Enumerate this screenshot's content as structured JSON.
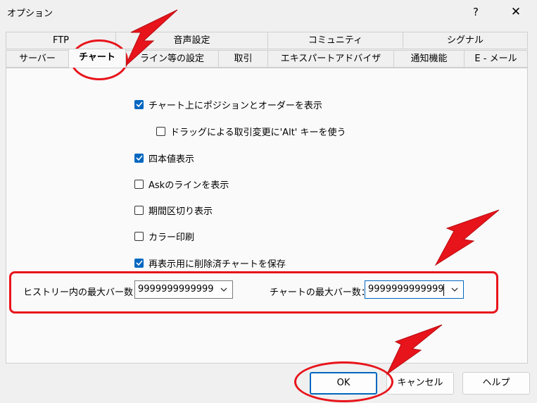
{
  "window": {
    "title": "オプション",
    "help_glyph": "?",
    "close_glyph": "✕"
  },
  "tabs_row1": [
    "FTP",
    "音声設定",
    "コミュニティ",
    "シグナル"
  ],
  "tabs_row2": [
    "サーバー",
    "チャート",
    "ライン等の設定",
    "取引",
    "エキスパートアドバイザ",
    "通知機能",
    "E - メール"
  ],
  "active_tab": "チャート",
  "options": [
    {
      "label": "チャート上にポジションとオーダーを表示",
      "checked": true
    },
    {
      "label": "ドラッグによる取引変更に'Alt' キーを使う",
      "checked": false
    },
    {
      "label": "四本値表示",
      "checked": true
    },
    {
      "label": "Askのラインを表示",
      "checked": false
    },
    {
      "label": "期間区切り表示",
      "checked": false
    },
    {
      "label": "カラー印刷",
      "checked": false
    },
    {
      "label": "再表示用に削除済チャートを保存",
      "checked": true
    }
  ],
  "history_bars": {
    "label": "ヒストリー内の最大バー数",
    "value": "9999999999999"
  },
  "chart_bars": {
    "label": "チャートの最大バー数：",
    "value": "9999999999999"
  },
  "buttons": {
    "ok": "OK",
    "cancel": "キャンセル",
    "help": "ヘルプ"
  },
  "annotation_color": "#e8141b",
  "accent_color": "#0067c0"
}
